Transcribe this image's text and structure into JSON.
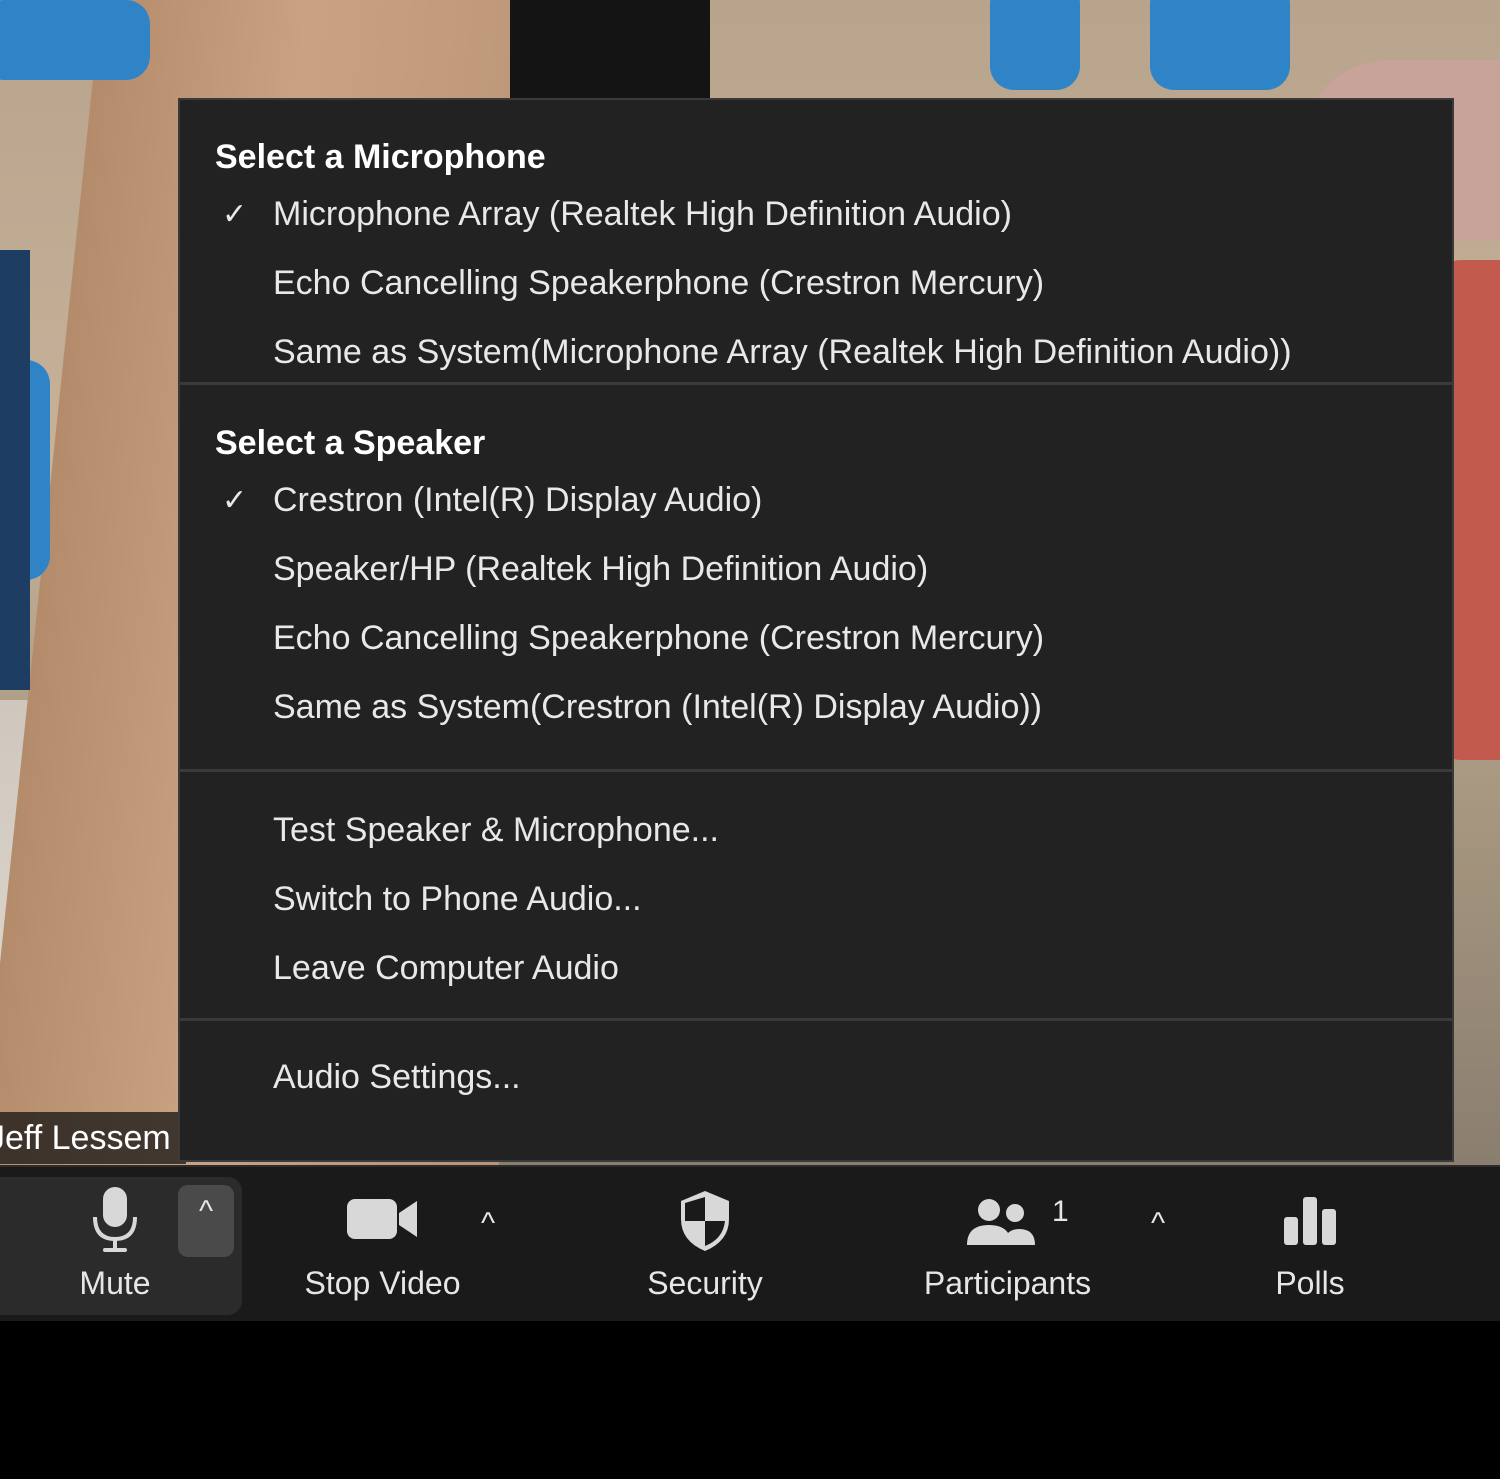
{
  "video": {
    "participant_name": "Jeff Lessem"
  },
  "audio_menu": {
    "microphone": {
      "title": "Select a Microphone",
      "items": [
        {
          "label": "Microphone Array (Realtek High Definition Audio)",
          "selected": true
        },
        {
          "label": "Echo Cancelling Speakerphone (Crestron Mercury)",
          "selected": false
        },
        {
          "label": "Same as System(Microphone Array (Realtek High Definition Audio))",
          "selected": false
        }
      ]
    },
    "speaker": {
      "title": "Select a Speaker",
      "items": [
        {
          "label": "Crestron (Intel(R) Display Audio)",
          "selected": true
        },
        {
          "label": "Speaker/HP (Realtek High Definition Audio)",
          "selected": false
        },
        {
          "label": "Echo Cancelling Speakerphone (Crestron Mercury)",
          "selected": false
        },
        {
          "label": "Same as System(Crestron (Intel(R) Display Audio))",
          "selected": false
        }
      ]
    },
    "actions": [
      {
        "label": "Test Speaker & Microphone..."
      },
      {
        "label": "Switch to Phone Audio..."
      },
      {
        "label": "Leave Computer Audio"
      }
    ],
    "settings": {
      "label": "Audio Settings..."
    },
    "check_glyph": "✓"
  },
  "toolbar": {
    "mute": {
      "label": "Mute",
      "icon": "microphone-icon"
    },
    "stop_video": {
      "label": "Stop Video",
      "icon": "video-camera-icon"
    },
    "security": {
      "label": "Security",
      "icon": "shield-icon"
    },
    "participants": {
      "label": "Participants",
      "icon": "participants-icon",
      "count": "1"
    },
    "polls": {
      "label": "Polls",
      "icon": "bar-chart-icon"
    },
    "caret_glyph": "^"
  },
  "colors": {
    "menu_bg": "#222222",
    "toolbar_bg": "#1a1a1a",
    "text": "#e8e8e8"
  }
}
